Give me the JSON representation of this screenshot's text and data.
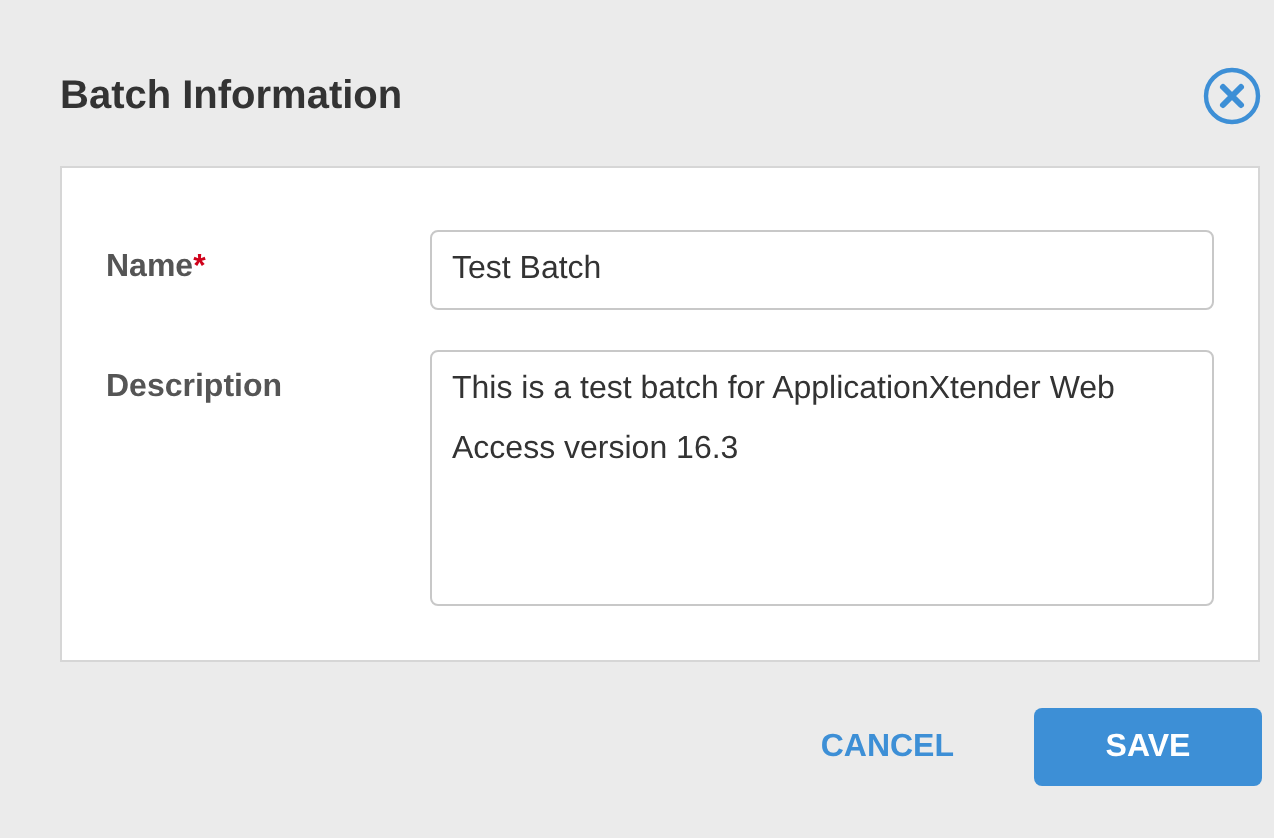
{
  "dialog": {
    "title": "Batch Information",
    "fields": [
      {
        "kind": "input",
        "label": "Name",
        "required_mark": "*",
        "value": "Test Batch"
      },
      {
        "kind": "textarea",
        "label": "Description",
        "value": "This is a test batch for ApplicationXtender Web Access version 16.3"
      }
    ],
    "buttons": [
      {
        "kind": "link",
        "label": "CANCEL"
      },
      {
        "kind": "primary",
        "label": "SAVE"
      }
    ]
  }
}
